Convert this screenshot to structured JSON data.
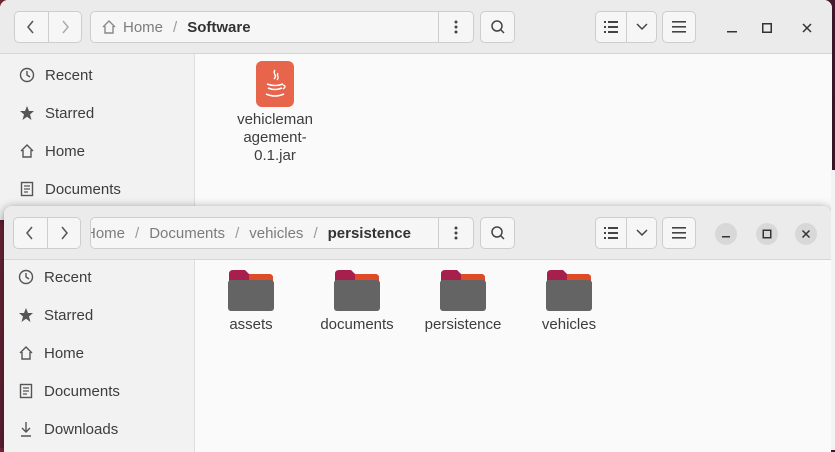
{
  "back_window": {
    "path": [
      "Home",
      "Software"
    ],
    "sidebar": [
      "Recent",
      "Starred",
      "Home",
      "Documents"
    ],
    "files": [
      {
        "name": "vehicleman\nagement-\n0.1.jar",
        "type": "java-jar"
      }
    ]
  },
  "front_window": {
    "path": [
      "Home",
      "Documents",
      "vehicles",
      "persistence"
    ],
    "path_display_first": "Home",
    "sidebar": [
      "Recent",
      "Starred",
      "Home",
      "Documents",
      "Downloads"
    ],
    "folders": [
      "assets",
      "documents",
      "persistence",
      "vehicles"
    ]
  },
  "colors": {
    "folder_body": "#646464",
    "folder_tab": "#a7204d",
    "folder_tab_accent": "#e95420",
    "java_icon_bg": "#e6654b"
  }
}
